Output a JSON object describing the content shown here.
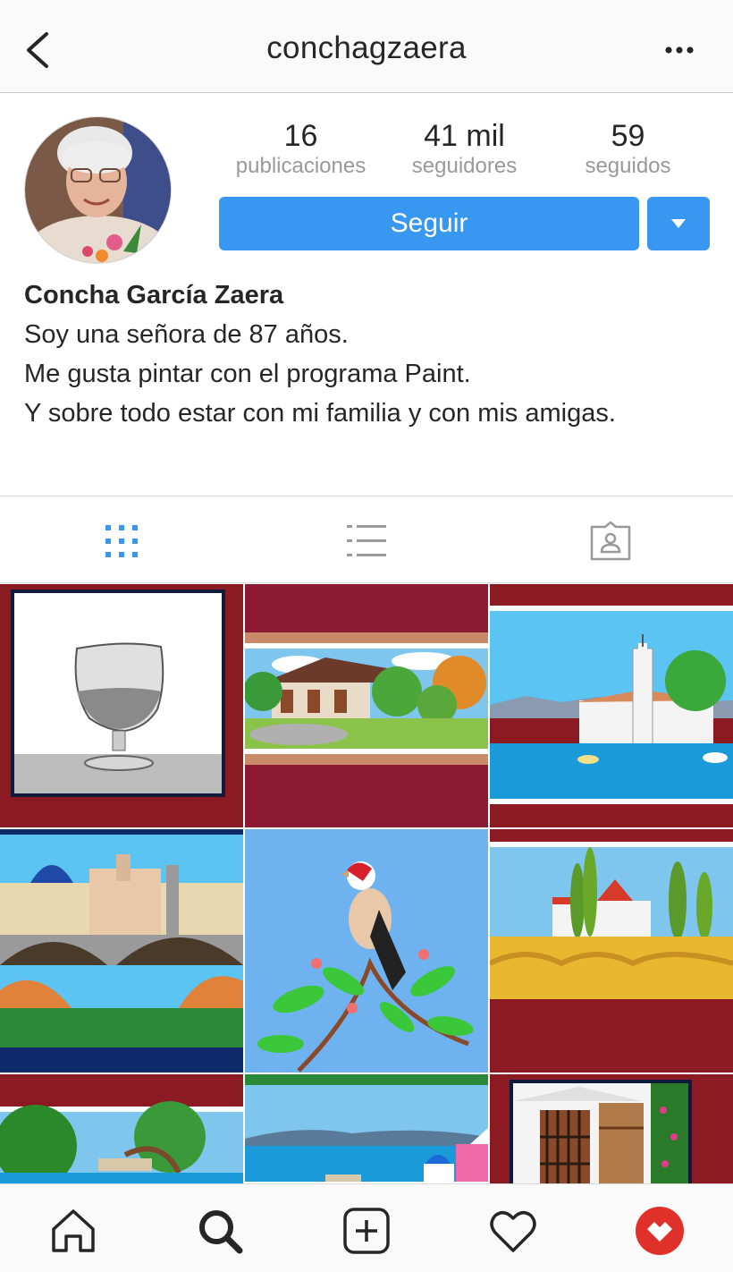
{
  "header": {
    "username": "conchagzaera",
    "back_icon": "chevron-left-icon",
    "more_icon": "more-horizontal-icon"
  },
  "profile": {
    "stats": [
      {
        "value": "16",
        "label": "publicaciones"
      },
      {
        "value": "41 mil",
        "label": "seguidores"
      },
      {
        "value": "59",
        "label": "seguidos"
      }
    ],
    "follow_label": "Seguir",
    "name": "Concha García Zaera",
    "bio": [
      "Soy una señora de 87 años.",
      "Me gusta pintar con el programa Paint.",
      "Y sobre todo estar con mi familia y con mis amigas."
    ]
  },
  "tabs": [
    {
      "icon": "grid-icon",
      "active": true
    },
    {
      "icon": "list-icon",
      "active": false
    },
    {
      "icon": "tagged-user-icon",
      "active": false
    }
  ],
  "posts": [
    "brandy-glass-painting",
    "japanese-house-painting",
    "coastal-church-painting",
    "city-bridge-painting",
    "goldfinch-painting",
    "tuscan-field-painting",
    "pine-trees-coast-painting",
    "greek-island-painting",
    "house-door-painting"
  ],
  "bottom_nav": [
    "home-icon",
    "search-icon",
    "add-post-icon",
    "activity-heart-icon",
    "profile-avatar-icon"
  ],
  "colors": {
    "accent": "#3897f0",
    "frame_red": "#8b1a22"
  }
}
